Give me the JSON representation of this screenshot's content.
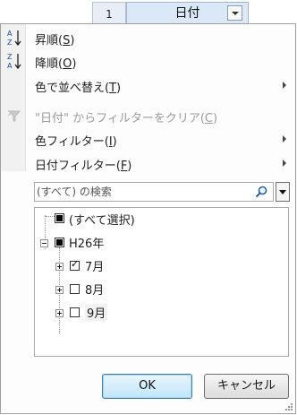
{
  "sheet": {
    "row_number": "1",
    "header_cell": "日付"
  },
  "menu": {
    "sort_asc": {
      "label": "昇順(",
      "accel": "S",
      "tail": ")",
      "icon": "sort-asc-icon"
    },
    "sort_desc": {
      "label": "降順(",
      "accel": "O",
      "tail": ")",
      "icon": "sort-desc-icon"
    },
    "sort_by_color": {
      "label": "色で並べ替え(",
      "accel": "T",
      "tail": ")"
    },
    "clear_filter": {
      "label": "\"日付\" からフィルターをクリア(",
      "accel": "C",
      "tail": ")",
      "icon": "clear-filter-icon"
    },
    "color_filter": {
      "label": "色フィルター(",
      "accel": "I",
      "tail": ")"
    },
    "date_filter": {
      "label": "日付フィルター(",
      "accel": "F",
      "tail": ")"
    }
  },
  "search": {
    "placeholder": "(すべて) の検索",
    "icon": "magnifier-icon"
  },
  "tree": {
    "select_all": "(すべて選択)",
    "year": "H26年",
    "months": [
      {
        "label": "7月",
        "checked": true
      },
      {
        "label": "8月",
        "checked": false
      },
      {
        "label": "9月",
        "checked": false
      }
    ]
  },
  "buttons": {
    "ok": "OK",
    "cancel": "キャンセル"
  },
  "colors": {
    "header_fill": "#dbe8f7",
    "ok_border": "#3c7fb1",
    "disabled_text": "#9a9a9a"
  }
}
